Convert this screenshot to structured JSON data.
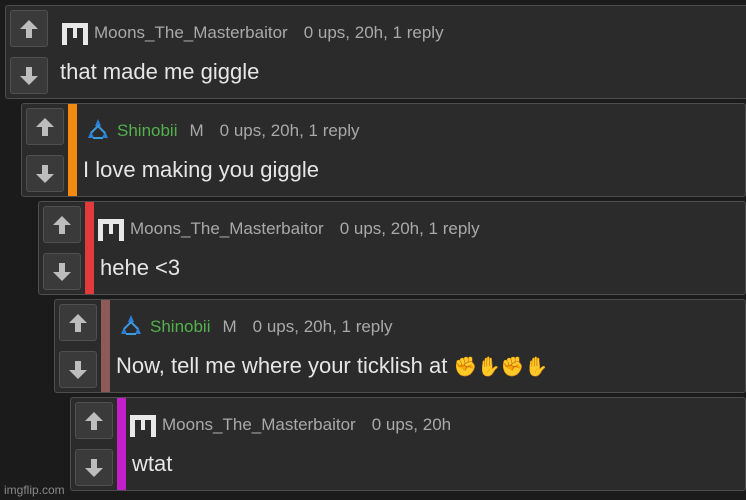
{
  "comments": [
    {
      "username": "Moons_The_Masterbaitor",
      "mod_tag": "",
      "meta": "0 ups, 20h, 1 reply",
      "text": "that made me giggle",
      "stripe_color": ""
    },
    {
      "username": "Shinobii",
      "mod_tag": "M",
      "meta": "0 ups, 20h, 1 reply",
      "text": "I love making you giggle",
      "stripe_color": "#f28a12"
    },
    {
      "username": "Moons_The_Masterbaitor",
      "mod_tag": "",
      "meta": "0 ups, 20h, 1 reply",
      "text": "hehe <3",
      "stripe_color": "#e23a3a"
    },
    {
      "username": "Shinobii",
      "mod_tag": "M",
      "meta": "0 ups, 20h, 1 reply",
      "text": "Now, tell me where your ticklish at",
      "emoji": "✊✋✊✋",
      "stripe_color": "#8c5b57"
    },
    {
      "username": "Moons_The_Masterbaitor",
      "mod_tag": "",
      "meta": "0 ups, 20h",
      "text": "wtat",
      "stripe_color": "#c21ec9"
    }
  ],
  "colors": {
    "background": "#1b1b1b",
    "card": "#2b2b2b",
    "username_green": "#52b14c",
    "meta_gray": "#a9a9a9"
  },
  "icons": [
    "upvote-arrow-icon",
    "downvote-arrow-icon",
    "pixel-m-avatar-icon",
    "stars-triangle-avatar-icon"
  ],
  "watermark": "imgflip.com"
}
